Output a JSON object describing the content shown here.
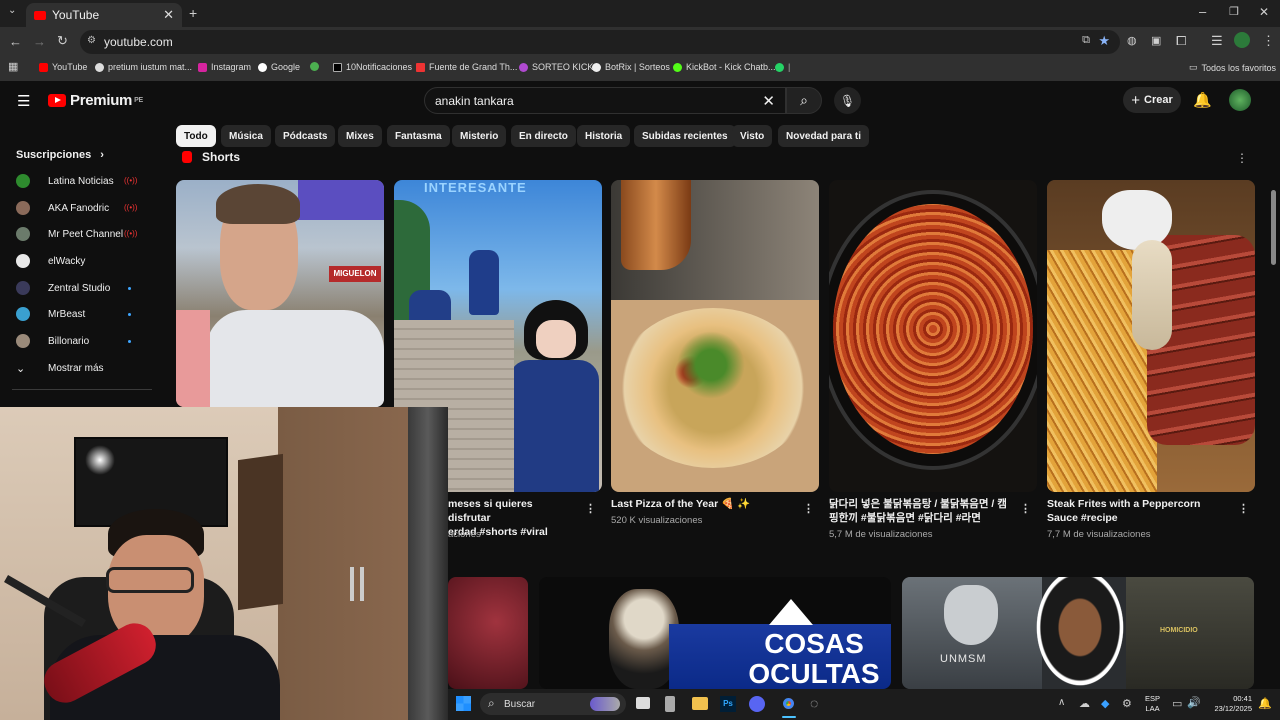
{
  "browser": {
    "tab_title": "YouTube",
    "url": "youtube.com",
    "bookmarks": [
      "YouTube",
      "pretium iustum mat...",
      "Instagram",
      "Google",
      "10Notificaciones",
      "Fuente de Grand Th...",
      "SORTEO KICK",
      "BotRix | Sorteos",
      "KickBot - Kick Chatb..."
    ],
    "all_bookmarks": "Todos los favoritos"
  },
  "header": {
    "logo": "Premium",
    "logo_region": "PE",
    "search_value": "anakin tankara",
    "create_label": "Crear"
  },
  "chips": [
    "Todo",
    "Música",
    "Pódcasts",
    "Mixes",
    "Fantasma",
    "Misterio",
    "En directo",
    "Historia",
    "Subidas recientes",
    "Visto",
    "Novedad para ti"
  ],
  "sidebar": {
    "subscriptions_title": "Suscripciones",
    "items": [
      {
        "label": "Latina Noticias",
        "color": "#2e8b2e"
      },
      {
        "label": "AKA Fanodric",
        "color": "#8a6a5a"
      },
      {
        "label": "Mr Peet Channel",
        "color": "#6b7b6b"
      },
      {
        "label": "elWacky",
        "color": "#e8e8e8"
      },
      {
        "label": "Zentral Studio",
        "color": "#3a3a5a"
      },
      {
        "label": "MrBeast",
        "color": "#3aa0d0"
      },
      {
        "label": "Billonario",
        "color": "#9a8a7a"
      }
    ],
    "show_more": "Mostrar más"
  },
  "shorts": {
    "section_title": "Shorts",
    "items": [
      {
        "title": "",
        "views": ""
      },
      {
        "title": "meses si quieres disfrutar\nerdad #shorts #viral",
        "views": "aciones"
      },
      {
        "title": "Last Pizza of the Year 🍕 ✨",
        "views": "520 K visualizaciones"
      },
      {
        "title": "닭다리 넣은 불닭볶음탕 / 불닭볶음면 / 캠핑한끼 #불닭볶음면 #닭다리 #라면",
        "views": "5,7 M de visualizaciones"
      },
      {
        "title": "Steak Frites with a Peppercorn Sauce #recipe",
        "views": "7,7 M de visualizaciones"
      }
    ],
    "overlay_texts": [
      "INTERESANTE",
      "MIGUELON"
    ]
  },
  "videos": {
    "cosas_ocultas": "COSAS\nOCULTAS",
    "unmsm": "UNMSM",
    "homicidio": "HOMICIDIO"
  },
  "taskbar": {
    "search_placeholder": "Buscar",
    "lang_top": "ESP",
    "lang_bottom": "LAA",
    "time": "00:41",
    "date": "23/12/2025"
  }
}
